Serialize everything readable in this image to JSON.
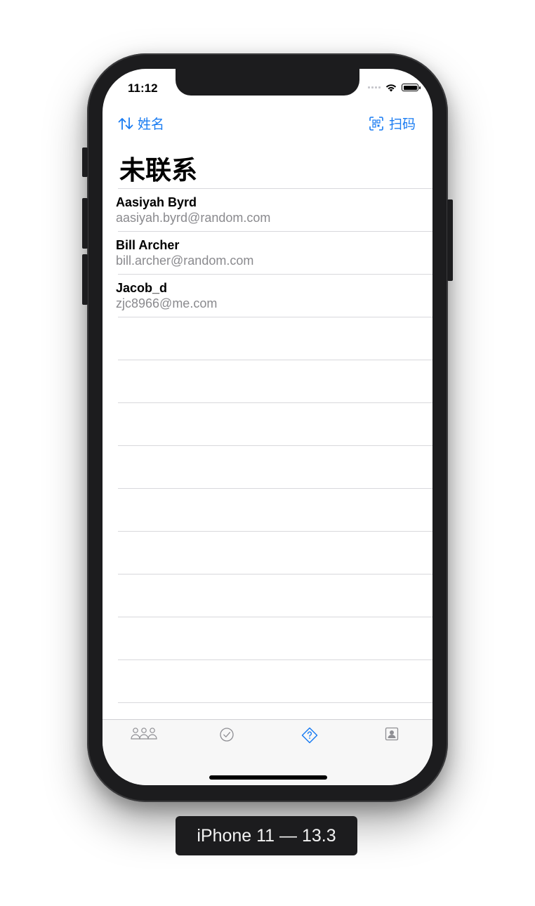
{
  "status_bar": {
    "time": "11:12"
  },
  "nav": {
    "sort_label": "姓名",
    "scan_label": "扫码"
  },
  "title": "未联系",
  "contacts": [
    {
      "name": "Aasiyah Byrd",
      "email": "aasiyah.byrd@random.com"
    },
    {
      "name": "Bill Archer",
      "email": "bill.archer@random.com"
    },
    {
      "name": "Jacob_d",
      "email": "zjc8966@me.com"
    }
  ],
  "tabs": [
    {
      "icon": "people-icon",
      "selected": false
    },
    {
      "icon": "checkmark-circle-icon",
      "selected": false
    },
    {
      "icon": "question-diamond-icon",
      "selected": true
    },
    {
      "icon": "contact-card-icon",
      "selected": false
    }
  ],
  "colors": {
    "accent": "#1a7cf2",
    "tab_inactive": "#8e8e93"
  },
  "device_label": "iPhone 11 — 13.3"
}
